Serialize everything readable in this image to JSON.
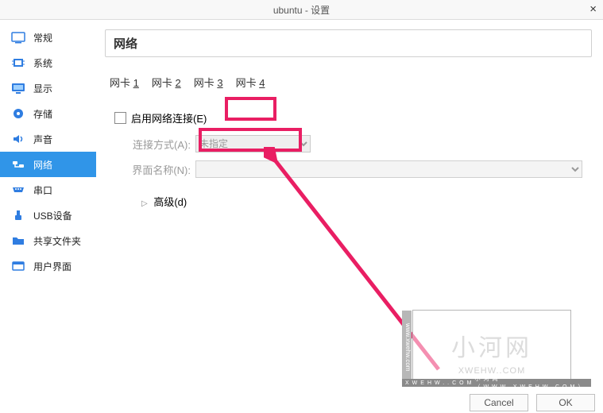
{
  "window": {
    "title": "ubuntu - 设置"
  },
  "sidebar": {
    "items": [
      {
        "label": "常规"
      },
      {
        "label": "系统"
      },
      {
        "label": "显示"
      },
      {
        "label": "存储"
      },
      {
        "label": "声音"
      },
      {
        "label": "网络"
      },
      {
        "label": "串口"
      },
      {
        "label": "USB设备"
      },
      {
        "label": "共享文件夹"
      },
      {
        "label": "用户界面"
      }
    ]
  },
  "panel": {
    "title": "网络"
  },
  "tabs": [
    {
      "prefix": "网卡 ",
      "key": "1"
    },
    {
      "prefix": "网卡 ",
      "key": "2"
    },
    {
      "prefix": "网卡 ",
      "key": "3"
    },
    {
      "prefix": "网卡 ",
      "key": "4"
    }
  ],
  "form": {
    "enable_label": "启用网络连接(E)",
    "attach_label": "连接方式(A):",
    "attach_value": "未指定",
    "iface_label": "界面名称(N):",
    "advanced_label": "高级(d)"
  },
  "footer": {
    "cancel": "Cancel",
    "ok": "OK"
  },
  "watermark": {
    "text": "小河网",
    "sub": "XWEHW..COM",
    "side": "www.xwehw.com",
    "strip_l": "XWEHW..COM",
    "strip_r": "小河网（WWW.XWEHW.COM）"
  }
}
